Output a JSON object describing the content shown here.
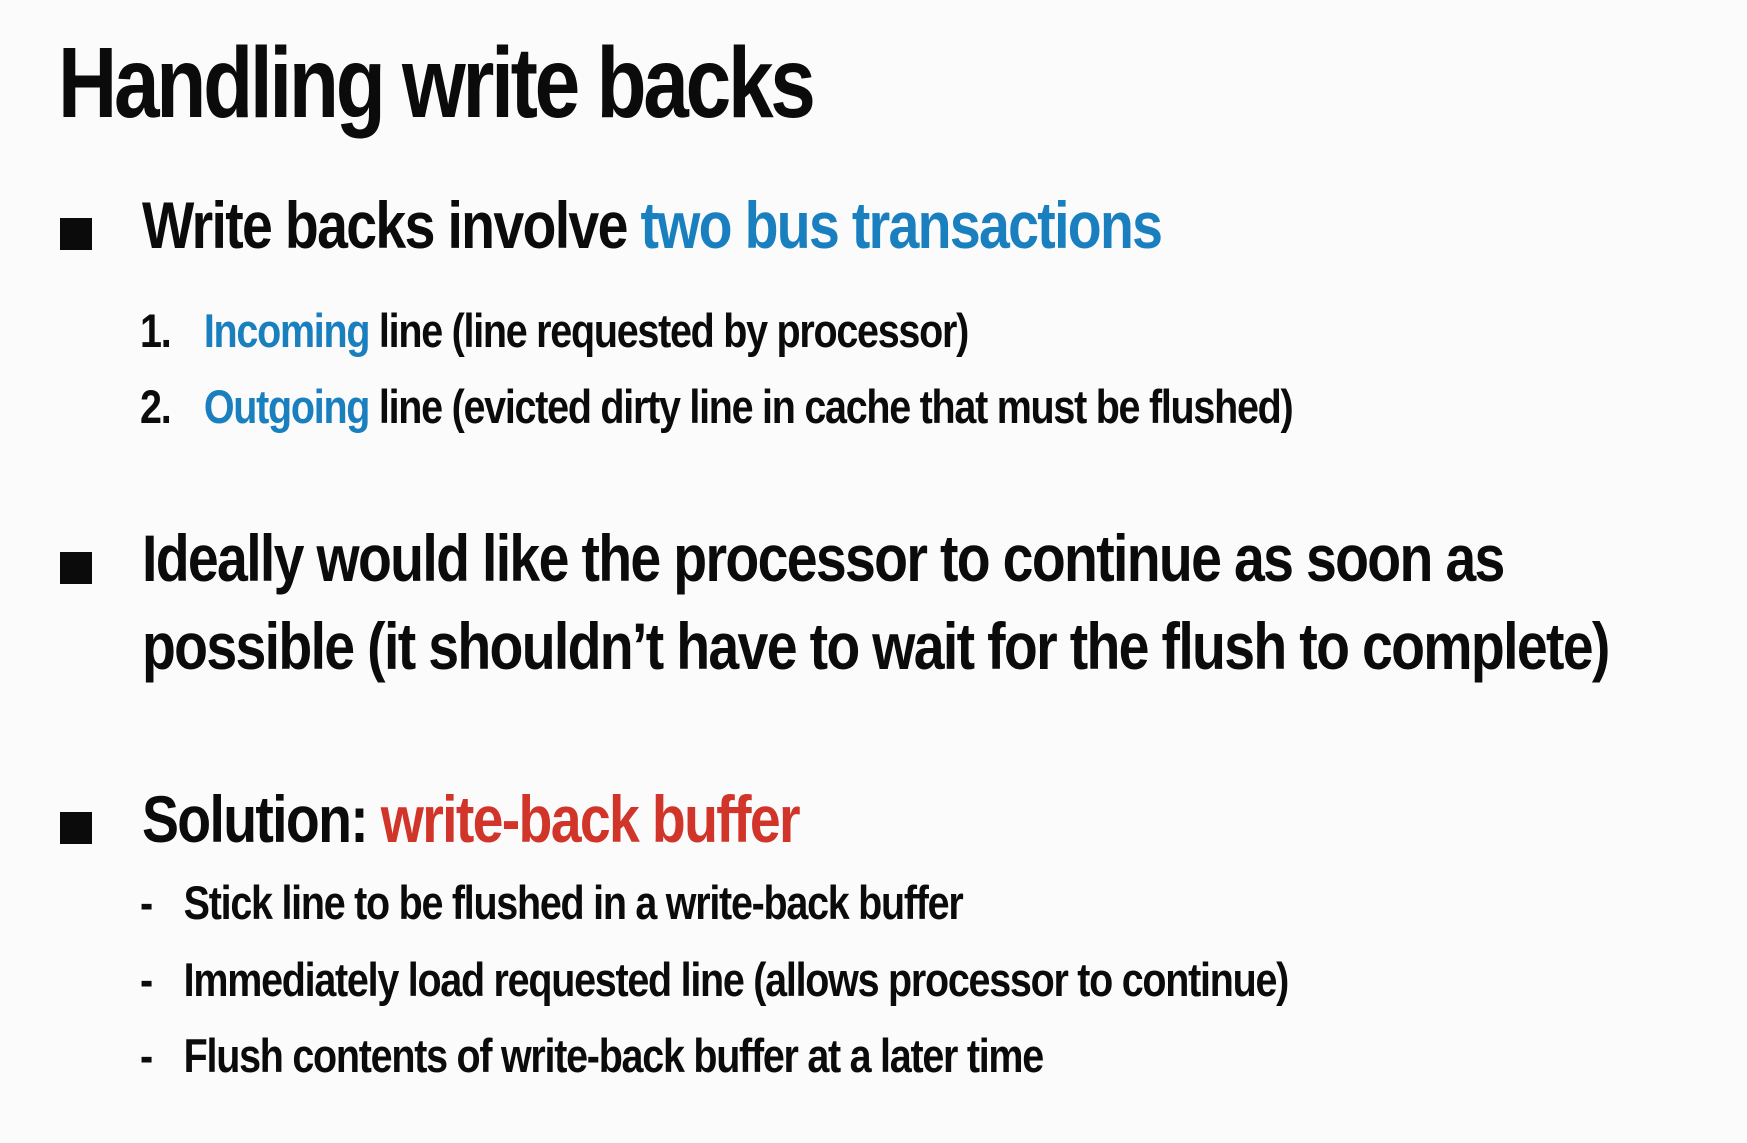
{
  "slide": {
    "title": "Handling write backs",
    "colors": {
      "text": "#0b0b0b",
      "accent_blue": "#1a7fbf",
      "accent_red": "#d1352a",
      "background": "#fbfbfb"
    },
    "bullet1": {
      "icon": "square-bullet-icon",
      "text_prefix": "Write backs involve ",
      "highlight": "two bus transactions",
      "items": [
        {
          "number": "1.",
          "highlight": "Incoming",
          "rest": " line (line requested by processor)"
        },
        {
          "number": "2.",
          "highlight": "Outgoing",
          "rest": " line (evicted dirty line in cache that must be flushed)"
        }
      ]
    },
    "bullet2": {
      "icon": "square-bullet-icon",
      "line1": "Ideally would like the processor to continue as soon as",
      "line2": "possible (it shouldn’t have to wait for the flush to complete)"
    },
    "bullet3": {
      "icon": "square-bullet-icon",
      "text_prefix": "Solution: ",
      "highlight": "write-back buffer",
      "items": [
        {
          "marker": "-",
          "text": "Stick line to be flushed in a write-back buffer"
        },
        {
          "marker": "-",
          "text": "Immediately load requested line (allows processor to continue)"
        },
        {
          "marker": "-",
          "text": "Flush contents of write-back buffer at a later time"
        }
      ]
    }
  }
}
